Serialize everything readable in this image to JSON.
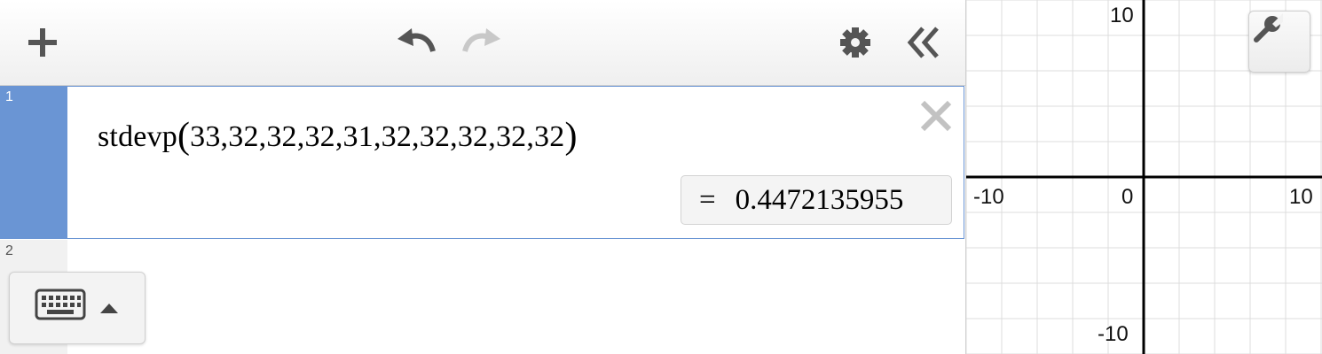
{
  "toolbar": {
    "add_icon": "plus-icon",
    "undo_icon": "undo-icon",
    "redo_icon": "redo-icon",
    "settings_icon": "gear-icon",
    "collapse_icon": "double-chevron-left-icon"
  },
  "expressions": [
    {
      "number": "1",
      "function": "stdevp",
      "open_paren": "(",
      "args": "33,32,32,32,31,32,32,32,32,32",
      "close_paren": ")",
      "result_equals": "=",
      "result_value": "0.4472135955",
      "selected": true
    },
    {
      "number": "2",
      "function": "",
      "args": "",
      "selected": false
    }
  ],
  "keyboard": {
    "icon": "keyboard-icon",
    "toggle_icon": "caret-up-icon"
  },
  "graph": {
    "ticks": {
      "y_top": "10",
      "x_left": "-10",
      "origin": "0",
      "x_right": "10",
      "y_bottom": "-10"
    },
    "settings_icon": "wrench-icon",
    "colors": {
      "gridline": "#dcdcdc",
      "axis": "#000000"
    }
  },
  "colors": {
    "selected_gutter": "#6a95d4",
    "icon_gray": "#555555",
    "disabled_icon": "#c8c8c8"
  }
}
